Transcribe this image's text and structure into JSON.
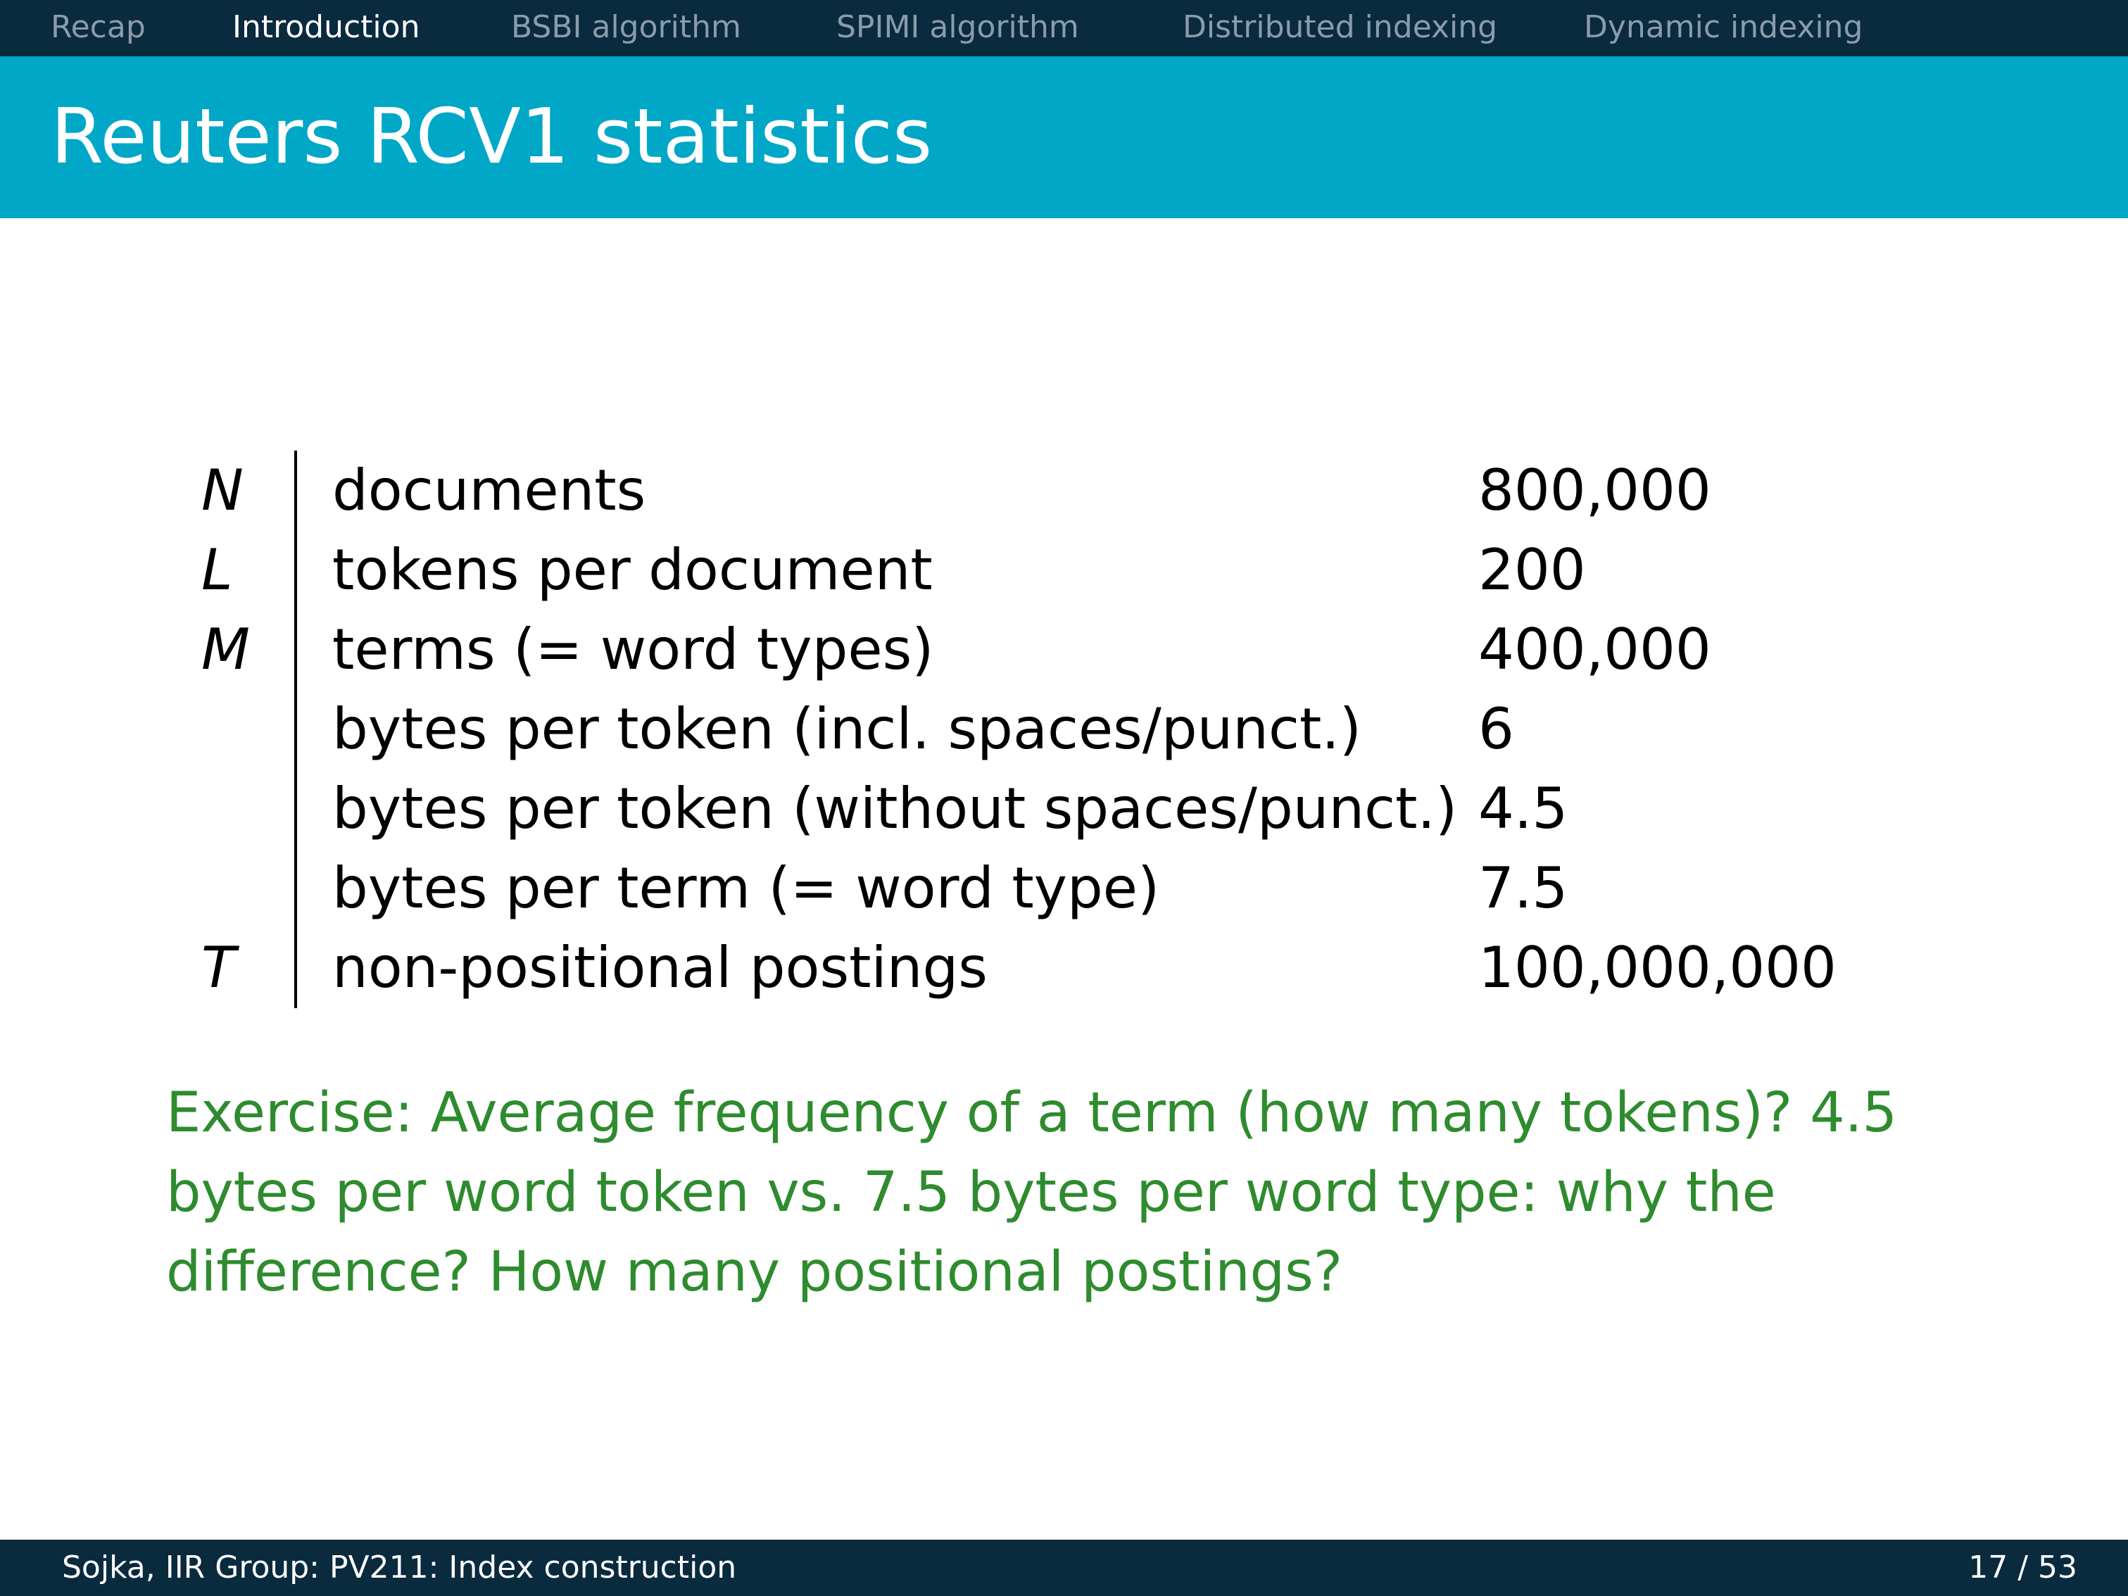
{
  "nav": {
    "items": [
      "Recap",
      "Introduction",
      "BSBI algorithm",
      "SPIMI algorithm",
      "Distributed indexing",
      "Dynamic indexing"
    ],
    "active": "Introduction"
  },
  "slide": {
    "title": "Reuters RCV1 statistics"
  },
  "stats": [
    {
      "symbol": "N",
      "description": "documents",
      "value": "800,000"
    },
    {
      "symbol": "L",
      "description": "tokens per document",
      "value": "200"
    },
    {
      "symbol": "M",
      "description": "terms (= word types)",
      "value": "400,000"
    },
    {
      "symbol": "",
      "description": "bytes per token (incl. spaces/punct.)",
      "value": "6"
    },
    {
      "symbol": "",
      "description": "bytes per token (without spaces/punct.)",
      "value": "4.5"
    },
    {
      "symbol": "",
      "description": "bytes per term (= word type)",
      "value": "7.5"
    },
    {
      "symbol": "T",
      "description": "non-positional postings",
      "value": "100,000,000"
    }
  ],
  "exercise": {
    "text": "Exercise: Average frequency of a term (how many tokens)? 4.5 bytes per word token vs. 7.5 bytes per word type: why the difference? How many positional postings?"
  },
  "footer": {
    "left": "Sojka, IIR Group: PV211: Index construction",
    "page": "17 / 53"
  },
  "colors": {
    "nav_bg": "#0a2a3e",
    "title_bg": "#00a7c6",
    "exercise_text": "#2e8b2e"
  }
}
